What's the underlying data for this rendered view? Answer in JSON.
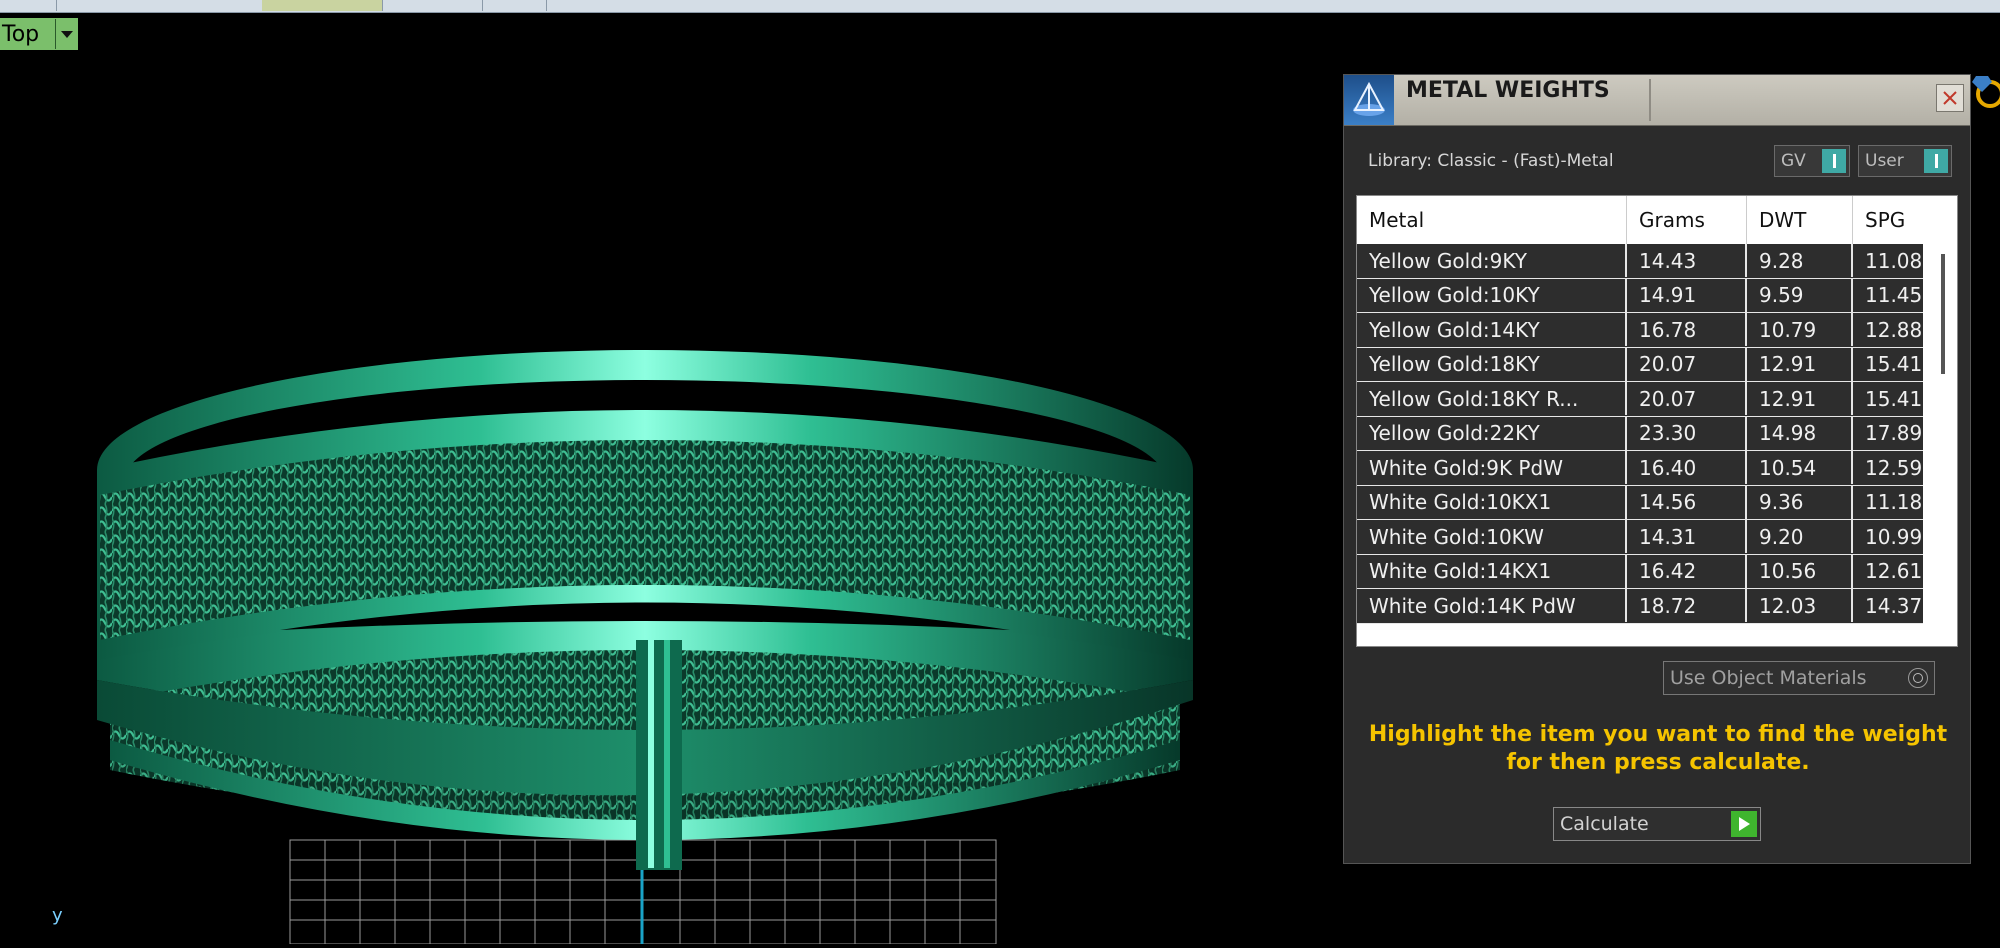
{
  "view": {
    "label": "Top"
  },
  "axis": {
    "y_label": "y"
  },
  "panel": {
    "title": "METAL WEIGHTS",
    "library_label": "Library: Classic - (Fast)-Metal",
    "toggles": [
      {
        "label": "GV"
      },
      {
        "label": "User"
      }
    ],
    "table": {
      "columns": [
        "Metal",
        "Grams",
        "DWT",
        "SPG"
      ],
      "rows": [
        {
          "metal": "Yellow Gold:9KY",
          "grams": "14.43",
          "dwt": "9.28",
          "spg": "11.08"
        },
        {
          "metal": "Yellow Gold:10KY",
          "grams": "14.91",
          "dwt": "9.59",
          "spg": "11.45"
        },
        {
          "metal": "Yellow Gold:14KY",
          "grams": "16.78",
          "dwt": "10.79",
          "spg": "12.88"
        },
        {
          "metal": "Yellow Gold:18KY",
          "grams": "20.07",
          "dwt": "12.91",
          "spg": "15.41"
        },
        {
          "metal": "Yellow Gold:18KY R...",
          "grams": "20.07",
          "dwt": "12.91",
          "spg": "15.41"
        },
        {
          "metal": "Yellow Gold:22KY",
          "grams": "23.30",
          "dwt": "14.98",
          "spg": "17.89"
        },
        {
          "metal": "White Gold:9K PdW",
          "grams": "16.40",
          "dwt": "10.54",
          "spg": "12.59"
        },
        {
          "metal": "White Gold:10KX1",
          "grams": "14.56",
          "dwt": "9.36",
          "spg": "11.18"
        },
        {
          "metal": "White Gold:10KW",
          "grams": "14.31",
          "dwt": "9.20",
          "spg": "10.99"
        },
        {
          "metal": "White Gold:14KX1",
          "grams": "16.42",
          "dwt": "10.56",
          "spg": "12.61"
        },
        {
          "metal": "White Gold:14K PdW",
          "grams": "18.72",
          "dwt": "12.03",
          "spg": "14.37"
        }
      ]
    },
    "use_object_materials_label": "Use Object Materials",
    "hint": "Highlight the item you want to find the weight for then press calculate.",
    "calculate_label": "Calculate"
  },
  "colors": {
    "ring": "#1f8f6a",
    "ring_highlight": "#7dffd6",
    "panel_bg": "#2b2b2b",
    "hint_text": "#f5c400",
    "accent_teal": "#3fa9a5",
    "accent_green": "#3fb52e"
  }
}
